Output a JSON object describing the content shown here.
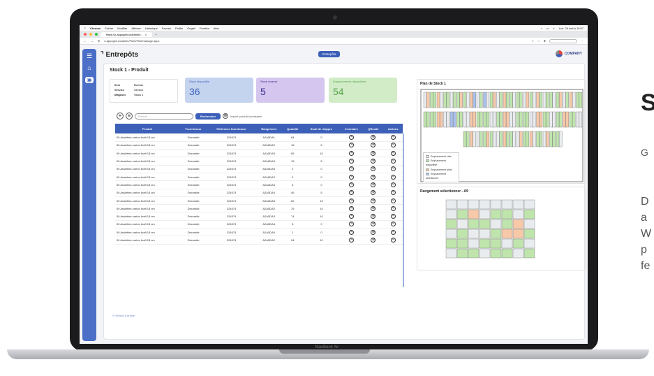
{
  "browser": {
    "menubar": {
      "items": [
        "Chrome",
        "Fichier",
        "Modifier",
        "Afficher",
        "Historique",
        "Favoris",
        "Profils",
        "Onglet",
        "Fenêtre",
        "Aide"
      ],
      "clock": "Lun. 29 mai à 19:57"
    },
    "tab_title": "https://u.appogen.io/admin/f...",
    "url": "u.appogen.io/admin/Fleet/Fleetmanage.aspx"
  },
  "app": {
    "page_title": "Entrepôts",
    "nav_pill": "Entrepôts",
    "logo_text": "COMPANY"
  },
  "stock": {
    "heading": "Stock 1 - Produit",
    "info": [
      {
        "label": "Item",
        "value": "Bureau"
      },
      {
        "label": "Service",
        "value": "Service"
      },
      {
        "label": "Magasin",
        "value": "Stock 1"
      }
    ],
    "stats": [
      {
        "label": "Stock disponible",
        "value": "36"
      },
      {
        "label": "Stock reservé",
        "value": "5"
      },
      {
        "label": "Emplacements disponibles",
        "value": "54"
      }
    ],
    "search_placeholder": "Produit",
    "search_button": "Rechercher",
    "import_label": "Import produit fournisseur",
    "columns": [
      "Produit",
      "Fournisseur",
      "Référence fournisseur",
      "Rangement",
      "Quantité",
      "Seuil de réappro",
      "Inventaire",
      "QRcode",
      "Actions"
    ],
    "rows": [
      [
        "50 Assiettes carton kraft 18 cm",
        "Décoralie",
        "324574",
        "A2A5DA1",
        "64",
        "0"
      ],
      [
        "50 Assiettes carton kraft 18 cm",
        "Décoralie",
        "324574",
        "A2A5DA2",
        "16",
        "5"
      ],
      [
        "50 Assiettes carton kraft 18 cm",
        "Décoralie",
        "324574",
        "A2A5DA3",
        "65",
        "10"
      ],
      [
        "50 Assiettes carton kraft 18 cm",
        "Décoralie",
        "324574",
        "A2A5DA4",
        "15",
        "5"
      ],
      [
        "50 Assiettes carton kraft 18 cm",
        "Décoralie",
        "324574",
        "A2A5DA5",
        "2",
        "0"
      ],
      [
        "50 Assiettes carton kraft 18 cm",
        "Décoralie",
        "324574",
        "A2A5DA2",
        "0",
        "0"
      ],
      [
        "50 Assiettes carton kraft 18 cm",
        "Décoralie",
        "324574",
        "A2A5DA3",
        "6",
        "0"
      ],
      [
        "50 Assiettes carton kraft 18 cm",
        "Décoralie",
        "324574",
        "A2A5DA4",
        "46",
        "5"
      ],
      [
        "50 Assiettes carton kraft 18 cm",
        "Décoralie",
        "324574",
        "A2A5DA5",
        "62",
        "10"
      ],
      [
        "50 Assiettes carton kraft 18 cm",
        "Décoralie",
        "324574",
        "A2A5DA2",
        "76",
        "10"
      ],
      [
        "50 Assiettes carton kraft 18 cm",
        "Décoralie",
        "324574",
        "A2A5DA3",
        "74",
        "10"
      ],
      [
        "50 Assiettes carton kraft 18 cm",
        "Décoralie",
        "324574",
        "A2A5DA4",
        "8",
        "0"
      ],
      [
        "50 Assiettes carton kraft 18 cm",
        "Décoralie",
        "324574",
        "A2A5DA5",
        "1",
        "0"
      ],
      [
        "50 Assiettes carton kraft 18 cm",
        "Décoralie",
        "324574",
        "A2A5DA2",
        "94",
        "10"
      ]
    ],
    "back_link": "Retour à la liste"
  },
  "plan": {
    "title": "Plan de Stock 1",
    "legend": [
      "Emplacement vide",
      "Emplacement disponible",
      "Emplacement plein",
      "Emplacement sélectionné"
    ],
    "legend_colors": [
      "#e9ecef",
      "#bfe5ad",
      "#f7c9a9",
      "#a9c2ec"
    ]
  },
  "rangement": {
    "title": "Rangement sélectionner - A9"
  },
  "device_label": "MacBook Air",
  "side_text": [
    "S",
    "G",
    "D",
    "a",
    "W",
    "p",
    "fe"
  ]
}
